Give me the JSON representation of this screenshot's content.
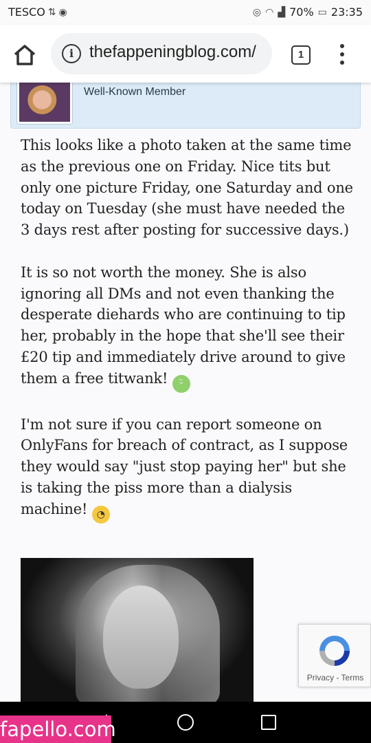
{
  "status_bar": {
    "carrier": "TESCO",
    "battery": "70%",
    "time": "23:35",
    "icons": [
      "sync-icon",
      "android-icon",
      "eye-icon",
      "wifi-icon",
      "signal-icon",
      "battery-icon"
    ]
  },
  "browser": {
    "url": "thefappeningblog.com/",
    "tab_count": "1",
    "icons": [
      "home-icon",
      "info-icon",
      "tabs-icon",
      "overflow-menu-icon"
    ]
  },
  "user_card": {
    "member_title": "Well-Known Member",
    "avatar_icon": "user-avatar"
  },
  "post": {
    "paragraph_1": "This looks like a photo taken at the same time as the previous one on Friday. Nice tits but only one picture Friday, one Saturday and one today on Tuesday (she must have needed the 3 days rest after posting for successive days.)",
    "paragraph_2": "It is so not worth the money. She is also ignoring all DMs and not even thanking the desperate diehards who are continuing to tip her, probably in the hope that she'll see their £20 tip and immediately drive around to give them a free titwank!",
    "paragraph_3": "I'm not sure if you can report someone on OnlyFans for breach of contract, as I suppose they would say \"just stop paying her\" but she is taking the piss more than a dialysis machine!",
    "emoji_1": "grinning-face-emoji",
    "emoji_2": "dizzy-face-emoji"
  },
  "recaptcha": {
    "links": "Privacy - Terms"
  },
  "nav_bar": {
    "icons": [
      "back-icon",
      "home-circle-icon",
      "recent-apps-icon"
    ]
  },
  "watermark": {
    "text": "fapello.com"
  },
  "colors": {
    "user_card_bg": "#dcebf7",
    "watermark_bg": "#e8338a",
    "recaptcha_blue": "#4a90e2"
  }
}
